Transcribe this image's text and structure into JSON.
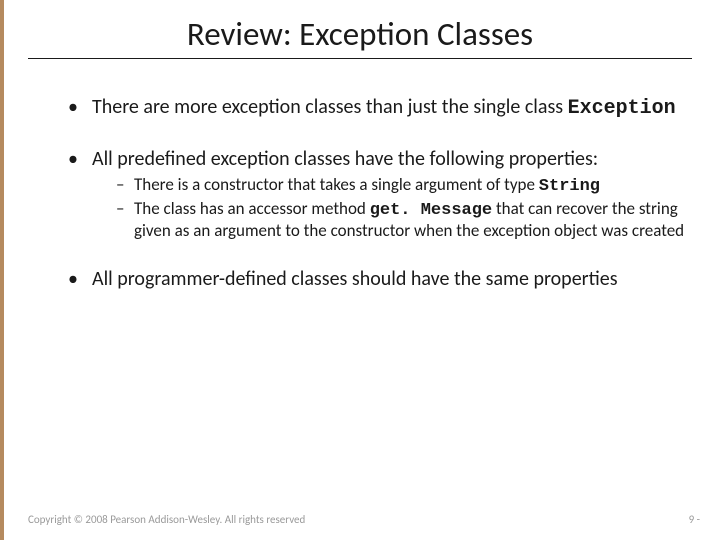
{
  "title": "Review: Exception Classes",
  "b1": {
    "pre": "There are more exception classes than just the single class ",
    "code": "Exception"
  },
  "b2": {
    "text": "All predefined exception classes have the following properties:",
    "s1": {
      "pre": "There is a constructor that takes a single argument of type ",
      "code": "String"
    },
    "s2": {
      "pre": "The class has an accessor method ",
      "code": "get. Message",
      "post": " that can recover the string given as an argument to the constructor when the exception object was created"
    }
  },
  "b3": {
    "text": "All programmer-defined classes should have the same properties"
  },
  "footer": {
    "copyright": "Copyright © 2008 Pearson Addison-Wesley. All rights reserved",
    "page": "9 -"
  }
}
